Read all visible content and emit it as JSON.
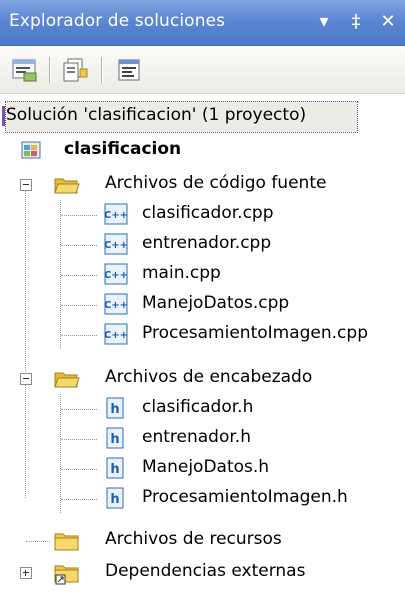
{
  "window": {
    "title": "Explorador de soluciones",
    "dropdown_glyph": "▾",
    "pin_glyph": "‡",
    "close_glyph": "✕"
  },
  "toolbar": {
    "buttons": [
      {
        "name": "properties-icon"
      },
      {
        "name": "show-all-files-icon"
      },
      {
        "name": "view-code-icon"
      }
    ]
  },
  "tree": {
    "solution": "Solución 'clasificacion' (1 proyecto)",
    "project": "clasificacion",
    "source_folder": "Archivos de código fuente",
    "source_files": [
      "clasificador.cpp",
      "entrenador.cpp",
      "main.cpp",
      "ManejoDatos.cpp",
      "ProcesamientoImagen.cpp"
    ],
    "header_folder": "Archivos de encabezado",
    "header_files": [
      "clasificador.h",
      "entrenador.h",
      "ManejoDatos.h",
      "ProcesamientoImagen.h"
    ],
    "resource_folder": "Archivos de recursos",
    "external_folder": "Dependencias externas"
  },
  "colors": {
    "titlebar": "#5b86d2",
    "selection": "#ecebe5",
    "folder": "#f2c94c",
    "cpp_icon": "#2a6fb8"
  }
}
